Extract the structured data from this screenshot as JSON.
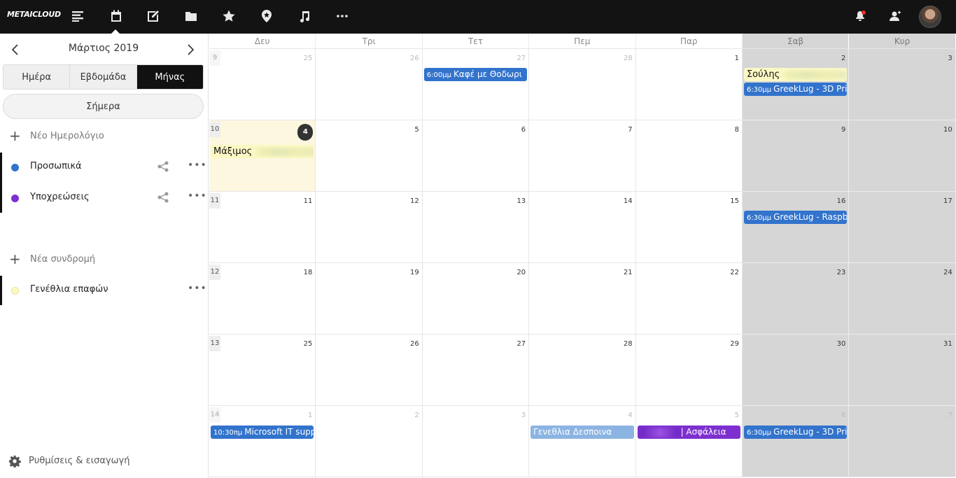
{
  "topbar": {
    "logo": "METAICLOUD",
    "apps": [
      "activity-icon",
      "calendar-icon",
      "notes-icon",
      "files-icon",
      "favorites-icon",
      "maps-icon",
      "music-icon",
      "more-icon"
    ],
    "right_icons": [
      "notifications-icon",
      "contacts-icon",
      "avatar"
    ]
  },
  "sidebar": {
    "month_label": "Μάρτιος 2019",
    "views": [
      "Ημέρα",
      "Εβδομάδα",
      "Μήνας"
    ],
    "active_view": "Μήνας",
    "today_label": "Σήμερα",
    "new_calendar": "Νέο Ημερολόγιο",
    "calendars": [
      {
        "label": "Προσωπικά",
        "color": "#3273cc"
      },
      {
        "label": "Υποχρεώσεις",
        "color": "#7d2fcf"
      }
    ],
    "new_subscription": "Νέα συνδρομή",
    "subscriptions": [
      {
        "label": "Γενέθλια επαφών",
        "color": "#fbf8c4"
      }
    ],
    "settings_label": "Ρυθμίσεις & εισαγωγή"
  },
  "calendar": {
    "weekdays": [
      "Δευ",
      "Τρι",
      "Τετ",
      "Πεμ",
      "Παρ",
      "Σαβ",
      "Κυρ"
    ],
    "weeks": [
      {
        "wk": "9",
        "days": [
          "25",
          "26",
          "27",
          "28",
          "1",
          "2",
          "3"
        ]
      },
      {
        "wk": "10",
        "days": [
          "4",
          "5",
          "6",
          "7",
          "8",
          "9",
          "10"
        ]
      },
      {
        "wk": "11",
        "days": [
          "11",
          "12",
          "13",
          "14",
          "15",
          "16",
          "17"
        ]
      },
      {
        "wk": "12",
        "days": [
          "18",
          "19",
          "20",
          "21",
          "22",
          "23",
          "24"
        ]
      },
      {
        "wk": "13",
        "days": [
          "25",
          "26",
          "27",
          "28",
          "29",
          "30",
          "31"
        ]
      },
      {
        "wk": "14",
        "days": [
          "1",
          "2",
          "3",
          "4",
          "5",
          "6",
          "7"
        ]
      }
    ],
    "events": {
      "w0_tue": {
        "time": "6:00μμ",
        "title": "Καφέ με Θοδωρι"
      },
      "w0_sat_bday": {
        "title": "Σούλης"
      },
      "w0_sat": {
        "time": "6:30μμ",
        "title": "GreekLug - 3D Pri"
      },
      "w1_mon_bday": {
        "title": "Μάξιμος"
      },
      "w2_sat": {
        "time": "6:30μμ",
        "title": "GreekLug - Raspb"
      },
      "w5_mon": {
        "time": "10:30πμ",
        "title": "Microsoft IT supp"
      },
      "w5_thu": {
        "title": "Γενεθλια Δεσποινα"
      },
      "w5_fri": {
        "title": "| Ασφάλεια"
      },
      "w5_sat": {
        "time": "6:30μμ",
        "title": "GreekLug - 3D Pri"
      }
    }
  }
}
